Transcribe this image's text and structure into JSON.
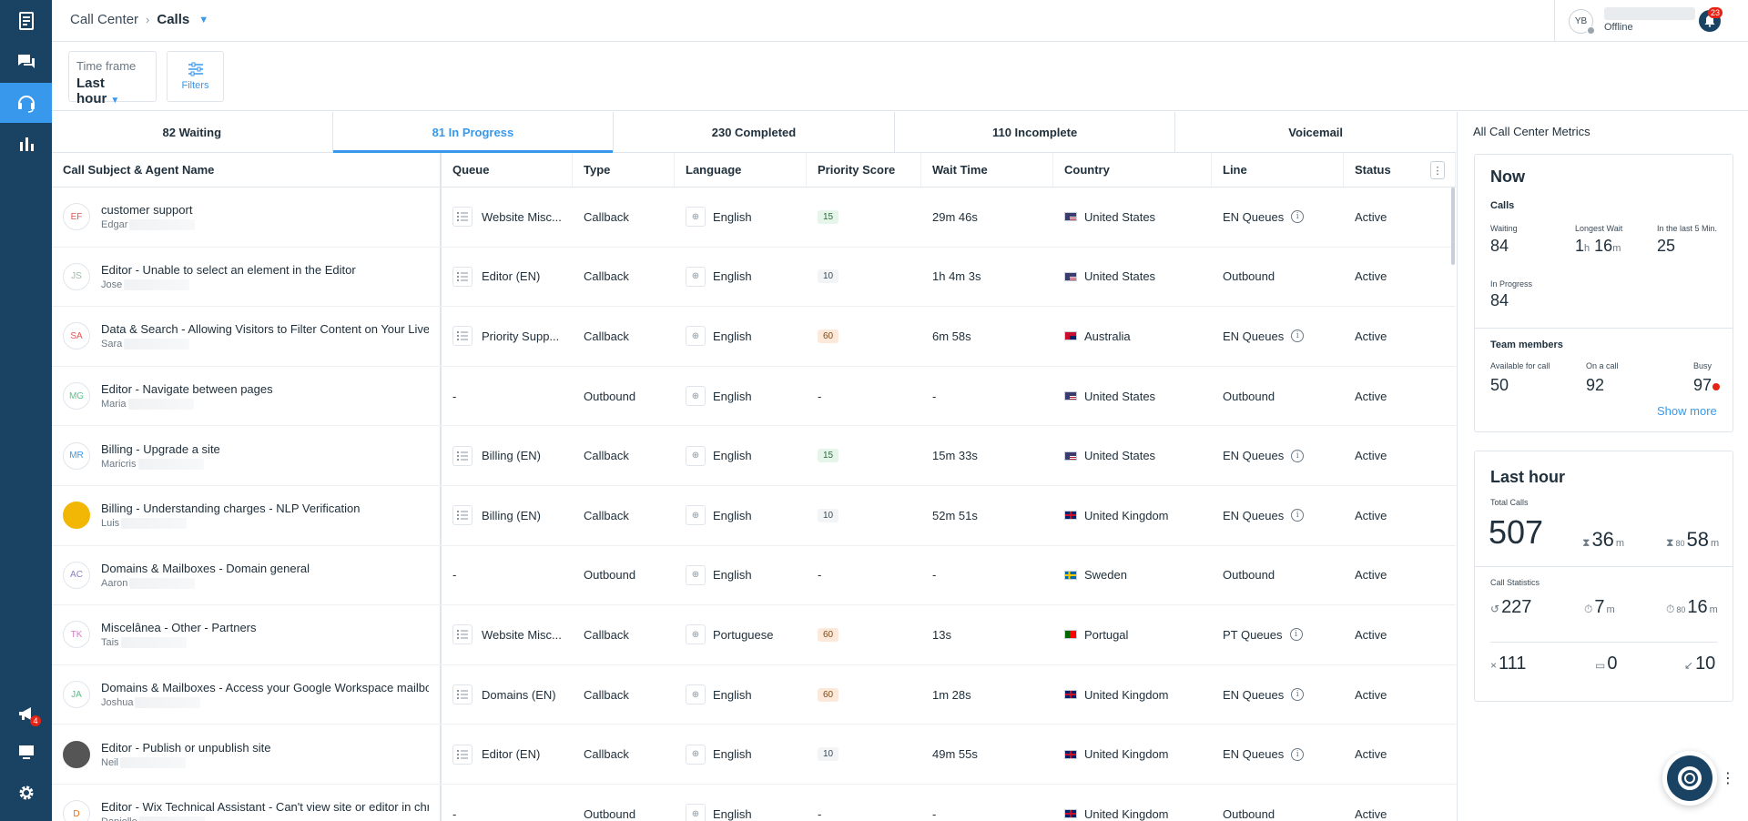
{
  "nav": {
    "announcements_badge": "4"
  },
  "header": {
    "breadcrumb_root": "Call Center",
    "breadcrumb_separator": "›",
    "breadcrumb_current": "Calls",
    "user_initials": "YB",
    "user_status": "Offline",
    "notifications_badge": "23"
  },
  "filters": {
    "timeframe_label": "Time frame",
    "timeframe_value": "Last hour",
    "filters_label": "Filters"
  },
  "tabs": [
    {
      "label": "82 Waiting"
    },
    {
      "label": "81 In Progress"
    },
    {
      "label": "230 Completed"
    },
    {
      "label": "110 Incomplete"
    },
    {
      "label": "Voicemail"
    }
  ],
  "table": {
    "columns": [
      "Call Subject & Agent Name",
      "Queue",
      "Type",
      "Language",
      "Priority Score",
      "Wait Time",
      "Country",
      "Line",
      "Status"
    ],
    "rows": [
      {
        "initials": "EF",
        "av_color": "#e05757",
        "subject": "customer support",
        "agent": "Edgar",
        "queue": "Website Misc...",
        "type": "Callback",
        "language": "English",
        "priority": "15",
        "wait": "29m 46s",
        "flag": "us",
        "country": "United States",
        "line": "EN Queues",
        "line_info": true,
        "status": "Active"
      },
      {
        "initials": "JS",
        "av_color": "#9fb7a4",
        "subject": "Editor - Unable to select an element in the Editor",
        "agent": "Jose",
        "queue": "Editor (EN)",
        "type": "Callback",
        "language": "English",
        "priority": "10",
        "wait": "1h 4m 3s",
        "flag": "us",
        "country": "United States",
        "line": "Outbound",
        "line_info": false,
        "status": "Active"
      },
      {
        "initials": "SA",
        "av_color": "#e05757",
        "subject": "Data & Search - Allowing Visitors to Filter Content on Your Live Site",
        "agent": "Sara",
        "queue": "Priority Supp...",
        "type": "Callback",
        "language": "English",
        "priority": "60",
        "wait": "6m 58s",
        "flag": "au",
        "country": "Australia",
        "line": "EN Queues",
        "line_info": true,
        "status": "Active"
      },
      {
        "initials": "MG",
        "av_color": "#5cc08a",
        "subject": "Editor - Navigate between pages",
        "agent": "Maria",
        "queue": "-",
        "type": "Outbound",
        "language": "English",
        "priority": "-",
        "wait": "-",
        "flag": "us",
        "country": "United States",
        "line": "Outbound",
        "line_info": false,
        "status": "Active"
      },
      {
        "initials": "MR",
        "av_color": "#3899ec",
        "subject": "Billing - Upgrade a site",
        "agent": "Maricris",
        "queue": "Billing (EN)",
        "type": "Callback",
        "language": "English",
        "priority": "15",
        "wait": "15m 33s",
        "flag": "us",
        "country": "United States",
        "line": "EN Queues",
        "line_info": true,
        "status": "Active"
      },
      {
        "initials": "",
        "av_color": "#f2b705",
        "subject": "Billing - Understanding charges - NLP Verification",
        "agent": "Luis",
        "queue": "Billing (EN)",
        "type": "Callback",
        "language": "English",
        "priority": "10",
        "wait": "52m 51s",
        "flag": "gb",
        "country": "United Kingdom",
        "line": "EN Queues",
        "line_info": true,
        "status": "Active"
      },
      {
        "initials": "AC",
        "av_color": "#8e7cc3",
        "subject": "Domains & Mailboxes - Domain general",
        "agent": "Aaron",
        "queue": "-",
        "type": "Outbound",
        "language": "English",
        "priority": "-",
        "wait": "-",
        "flag": "se",
        "country": "Sweden",
        "line": "Outbound",
        "line_info": false,
        "status": "Active"
      },
      {
        "initials": "TK",
        "av_color": "#d77ac4",
        "subject": "Miscelânea - Other - Partners",
        "agent": "Tais",
        "queue": "Website Misc...",
        "type": "Callback",
        "language": "Portuguese",
        "priority": "60",
        "wait": "13s",
        "flag": "pt",
        "country": "Portugal",
        "line": "PT Queues",
        "line_info": true,
        "status": "Active"
      },
      {
        "initials": "JA",
        "av_color": "#5cc08a",
        "subject": "Domains & Mailboxes - Access your Google Workspace mailbox",
        "agent": "Joshua",
        "queue": "Domains (EN)",
        "type": "Callback",
        "language": "English",
        "priority": "60",
        "wait": "1m 28s",
        "flag": "gb",
        "country": "United Kingdom",
        "line": "EN Queues",
        "line_info": true,
        "status": "Active"
      },
      {
        "initials": "",
        "av_color": "#555555",
        "subject": "Editor - Publish or unpublish site",
        "agent": "Neil",
        "queue": "Editor (EN)",
        "type": "Callback",
        "language": "English",
        "priority": "10",
        "wait": "49m 55s",
        "flag": "gb",
        "country": "United Kingdom",
        "line": "EN Queues",
        "line_info": true,
        "status": "Active"
      },
      {
        "initials": "D",
        "av_color": "#f06d0f",
        "subject": "Editor - Wix Technical Assistant - Can't view site or editor in chrome",
        "agent": "Danielle",
        "queue": "-",
        "type": "Outbound",
        "language": "English",
        "priority": "-",
        "wait": "-",
        "flag": "gb",
        "country": "United Kingdom",
        "line": "Outbound",
        "line_info": false,
        "status": "Active"
      }
    ]
  },
  "metrics": {
    "panel_title": "All Call Center Metrics",
    "now": {
      "title": "Now",
      "calls_label": "Calls",
      "waiting_label": "Waiting",
      "waiting_value": "84",
      "longest_wait_label": "Longest Wait",
      "longest_wait_h": "1",
      "longest_wait_h_unit": "h",
      "longest_wait_m": "16",
      "longest_wait_m_unit": "m",
      "last5_label": "In the last 5 Min.",
      "last5_value": "25",
      "in_progress_label": "In Progress",
      "in_progress_value": "84",
      "team_label": "Team members",
      "available_label": "Available for call",
      "available_value": "50",
      "on_call_label": "On a call",
      "on_call_value": "92",
      "busy_label": "Busy",
      "busy_value": "97",
      "show_more": "Show more"
    },
    "hour": {
      "title": "Last hour",
      "total_label": "Total Calls",
      "total_value": "507",
      "avg_wait": "36",
      "avg_wait_unit": "m",
      "p80_label": "80",
      "p80_wait": "58",
      "p80_wait_unit": "m",
      "stats_label": "Call Statistics",
      "answered": "227",
      "avg_duration": "7",
      "avg_duration_unit": "m",
      "p80_duration_label": "80",
      "p80_duration": "16",
      "p80_duration_unit": "m",
      "missed": "111",
      "voicemail": "0",
      "callbacks": "10"
    }
  }
}
